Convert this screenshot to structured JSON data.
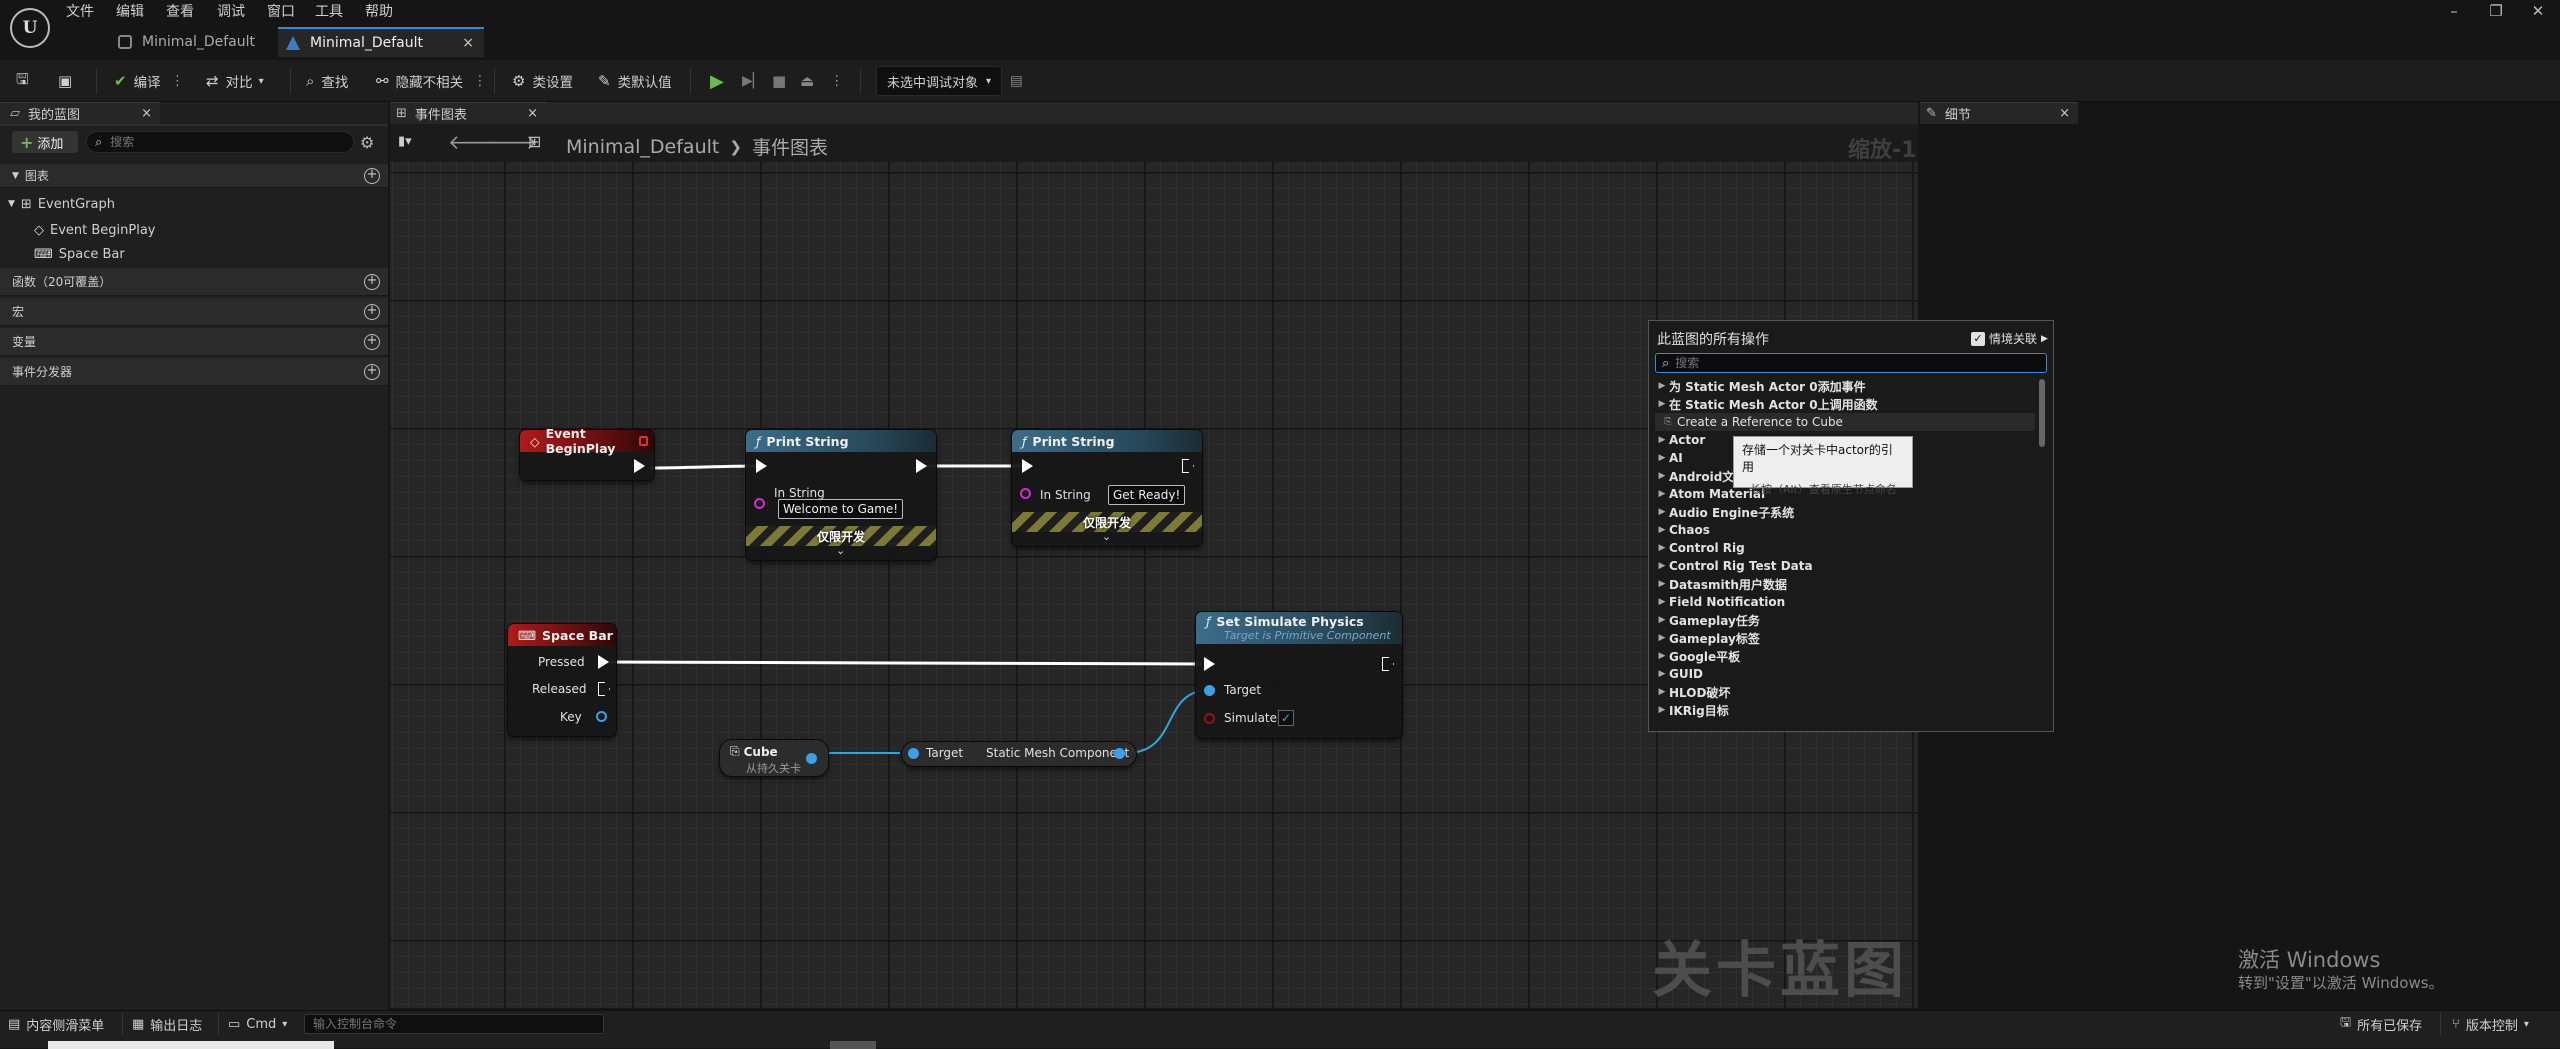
{
  "menu": [
    "文件",
    "编辑",
    "查看",
    "调试",
    "窗口",
    "工具",
    "帮助"
  ],
  "tabs": [
    {
      "label": "Minimal_Default",
      "active": false
    },
    {
      "label": "Minimal_Default",
      "active": true,
      "close": "×"
    }
  ],
  "window_controls": {
    "minimize": "–",
    "restore": "❐",
    "close": "✕"
  },
  "toolbar": {
    "compile": "编译",
    "diff": "对比",
    "find": "查找",
    "hide_unrelated": "隐藏不相关",
    "class_settings": "类设置",
    "class_defaults": "类默认值",
    "debug_object": "未选中调试对象"
  },
  "left_panel": {
    "tab": "我的蓝图",
    "add": "添加",
    "search_placeholder": "搜索",
    "sections": {
      "graphs": "图表",
      "functions": "函数（20可覆盖）",
      "macros": "宏",
      "variables": "变量",
      "dispatchers": "事件分发器"
    },
    "tree": {
      "event_graph": "EventGraph",
      "begin_play": "Event BeginPlay",
      "space_bar": "Space Bar"
    }
  },
  "graph": {
    "tab": "事件图表",
    "breadcrumb_root": "Minimal_Default",
    "breadcrumb_current": "事件图表",
    "zoom": "缩放-1",
    "watermark": "关卡蓝图",
    "nodes": {
      "begin_play": {
        "title": "Event BeginPlay"
      },
      "print1": {
        "title": "Print String",
        "in_label": "In String",
        "in_value": "Welcome to Game!",
        "dev": "仅限开发"
      },
      "print2": {
        "title": "Print String",
        "in_label": "In String",
        "in_value": "Get Ready!",
        "dev": "仅限开发"
      },
      "space_bar": {
        "title": "Space Bar",
        "pressed": "Pressed",
        "released": "Released",
        "key": "Key"
      },
      "set_physics": {
        "title": "Set Simulate Physics",
        "subtitle": "Target is Primitive Component",
        "target": "Target",
        "simulate": "Simulate"
      },
      "cube": {
        "title": "Cube",
        "subtitle": "从持久关卡"
      },
      "getter": {
        "target": "Target",
        "output": "Static Mesh Component"
      }
    }
  },
  "details": {
    "tab": "细节"
  },
  "action_menu": {
    "title": "此蓝图的所有操作",
    "context": "情境关联",
    "search_placeholder": "搜索",
    "items": [
      {
        "label": "为 Static Mesh Actor 0添加事件",
        "arrow": "▶"
      },
      {
        "label": "在 Static Mesh Actor 0上调用函数",
        "arrow": "▶"
      },
      {
        "label": "Create a Reference to Cube",
        "arrow": ""
      },
      {
        "label": "Actor",
        "arrow": "▶"
      },
      {
        "label": "AI",
        "arrow": "▶"
      },
      {
        "label": "Android文件",
        "arrow": "▶"
      },
      {
        "label": "Atom Material",
        "arrow": "▶"
      },
      {
        "label": "Audio Engine子系统",
        "arrow": "▶"
      },
      {
        "label": "Chaos",
        "arrow": "▶"
      },
      {
        "label": "Control Rig",
        "arrow": "▶"
      },
      {
        "label": "Control Rig Test Data",
        "arrow": "▶"
      },
      {
        "label": "Datasmith用户数据",
        "arrow": "▶"
      },
      {
        "label": "Field Notification",
        "arrow": "▶"
      },
      {
        "label": "Gameplay任务",
        "arrow": "▶"
      },
      {
        "label": "Gameplay标签",
        "arrow": "▶"
      },
      {
        "label": "Google平板",
        "arrow": "▶"
      },
      {
        "label": "GUID",
        "arrow": "▶"
      },
      {
        "label": "HLOD破坏",
        "arrow": "▶"
      },
      {
        "label": "IKRig目标",
        "arrow": "▶"
      }
    ],
    "tooltip_line1": "存储一个对关卡中actor的引用",
    "tooltip_line2": "长按（Alt）查看原生节点命名"
  },
  "activate_windows": {
    "line1": "激活 Windows",
    "line2": "转到\"设置\"以激活 Windows。"
  },
  "bottom": {
    "drawer": "内容侧滑菜单",
    "output_log": "输出日志",
    "cmd": "Cmd",
    "console_placeholder": "输入控制台命令",
    "saved": "所有已保存",
    "source_control": "版本控制"
  }
}
